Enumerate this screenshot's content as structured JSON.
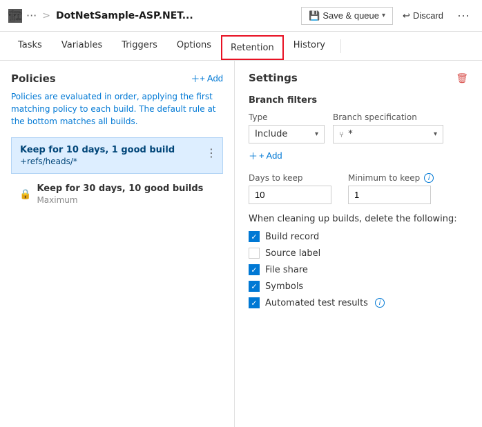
{
  "topbar": {
    "icon": "🏗",
    "dots": "···",
    "separator": ">",
    "title": "DotNetSample-ASP.NET...",
    "save_queue_label": "Save & queue",
    "discard_label": "Discard",
    "more": "···"
  },
  "tabs": [
    {
      "id": "tasks",
      "label": "Tasks",
      "active": false
    },
    {
      "id": "variables",
      "label": "Variables",
      "active": false
    },
    {
      "id": "triggers",
      "label": "Triggers",
      "active": false
    },
    {
      "id": "options",
      "label": "Options",
      "active": false
    },
    {
      "id": "retention",
      "label": "Retention",
      "active": true
    },
    {
      "id": "history",
      "label": "History",
      "active": false
    }
  ],
  "left": {
    "title": "Policies",
    "add_label": "+ Add",
    "description": "Policies are evaluated in order, applying the first matching policy to each build. The default rule at the bottom matches all builds.",
    "policies": [
      {
        "id": "p1",
        "name": "Keep for 10 days, 1 good build",
        "sub": "+refs/heads/*",
        "selected": true
      }
    ],
    "default_policy": {
      "name": "Keep for 30 days, 10 good builds",
      "sub": "Maximum"
    }
  },
  "right": {
    "title": "Settings",
    "branch_filters_label": "Branch filters",
    "type_label": "Type",
    "type_value": "Include",
    "branch_spec_label": "Branch specification",
    "branch_spec_value": "*",
    "add_filter_label": "+ Add",
    "days_to_keep_label": "Days to keep",
    "days_to_keep_value": "10",
    "min_to_keep_label": "Minimum to keep",
    "min_to_keep_value": "1",
    "delete_section_label": "When cleaning up builds, delete the following:",
    "checkboxes": [
      {
        "id": "build_record",
        "label": "Build record",
        "checked": true
      },
      {
        "id": "source_label",
        "label": "Source label",
        "checked": false
      },
      {
        "id": "file_share",
        "label": "File share",
        "checked": true
      },
      {
        "id": "symbols",
        "label": "Symbols",
        "checked": true
      },
      {
        "id": "automated_test",
        "label": "Automated test results",
        "checked": true,
        "has_info": true
      }
    ]
  }
}
